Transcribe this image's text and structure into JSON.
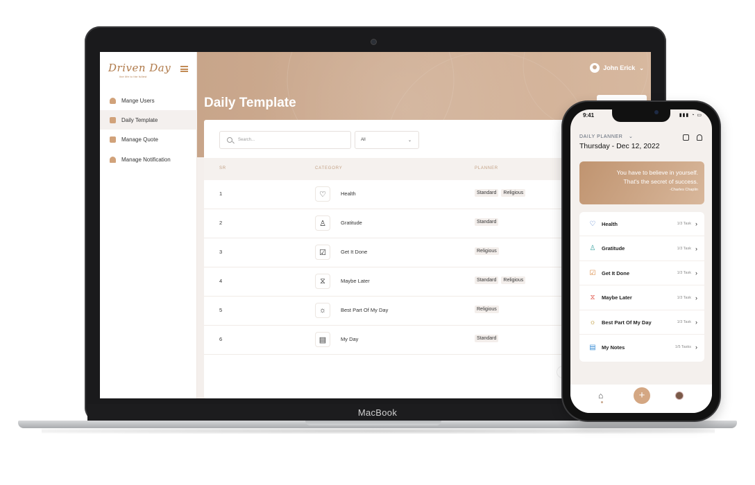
{
  "laptop": {
    "brand": "MacBook",
    "logo": {
      "title": "Driven Day",
      "tagline": "live life to the fullest"
    },
    "sidebar": {
      "items": [
        {
          "label": "Mange Users",
          "icon": "user-icon"
        },
        {
          "label": "Daily Template",
          "icon": "template-icon",
          "active": true
        },
        {
          "label": "Manage Quote",
          "icon": "quote-icon"
        },
        {
          "label": "Manage Notification",
          "icon": "bell-icon"
        }
      ]
    },
    "header": {
      "user_name": "John Erick",
      "chevron": "⌄"
    },
    "page_title": "Daily Template",
    "search": {
      "placeholder": "Search..."
    },
    "filter": {
      "value": "All",
      "chevron": "⌄"
    },
    "table": {
      "headers": [
        "Sr",
        "Category",
        "Planner"
      ],
      "rows": [
        {
          "sr": "1",
          "category": "Health",
          "icon": "♡",
          "tags": [
            "Standard",
            "Religious"
          ]
        },
        {
          "sr": "2",
          "category": "Gratitude",
          "icon": "♙",
          "tags": [
            "Standard"
          ]
        },
        {
          "sr": "3",
          "category": "Get It Done",
          "icon": "☑",
          "tags": [
            "Religious"
          ]
        },
        {
          "sr": "4",
          "category": "Maybe Later",
          "icon": "⧖",
          "tags": [
            "Standard",
            "Religious"
          ]
        },
        {
          "sr": "5",
          "category": "Best Part Of My Day",
          "icon": "☼",
          "tags": [
            "Religious"
          ]
        },
        {
          "sr": "6",
          "category": "My Day",
          "icon": "▤",
          "tags": [
            "Standard"
          ]
        }
      ]
    },
    "pager_prev": "‹"
  },
  "phone": {
    "status_time": "9:41",
    "status_icons": "▮▮▮ ◔ ▭",
    "planner_label": "DAILY PLANNER",
    "planner_chevron": "⌄",
    "date": "Thursday - Dec 12, 2022",
    "quote": {
      "line1": "You have to believe in yourself.",
      "line2": "That's the secret of success.",
      "author": "-Charles Chaplin"
    },
    "tasks": [
      {
        "name": "Health",
        "count": "1/3 Task",
        "icon": "♡",
        "color": "#3b6fc9"
      },
      {
        "name": "Gratitude",
        "count": "1/3 Task",
        "icon": "♙",
        "color": "#3aa3a0"
      },
      {
        "name": "Get It Done",
        "count": "1/3 Task",
        "icon": "☑",
        "color": "#d9853b"
      },
      {
        "name": "Maybe Later",
        "count": "1/3 Task",
        "icon": "⧖",
        "color": "#e0564a"
      },
      {
        "name": "Best Part Of My Day",
        "count": "1/3 Task",
        "icon": "☼",
        "color": "#b58a1e"
      },
      {
        "name": "My Notes",
        "count": "1/5 Tasks",
        "icon": "▤",
        "color": "#3c8fd6"
      }
    ],
    "task_chevron": "›",
    "tabbar": {
      "home": "⌂",
      "add": "+"
    }
  },
  "colors": {
    "accent": "#d4a783",
    "header": "#c8a58a",
    "sidebar_active": "#f4f0ee"
  }
}
